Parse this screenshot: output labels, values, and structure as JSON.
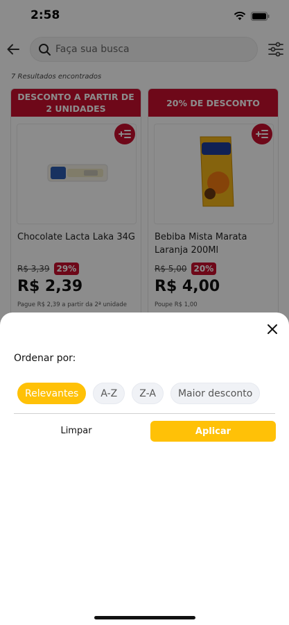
{
  "status_bar": {
    "time": "2:58",
    "wifi_icon": "wifi-icon",
    "battery_icon": "battery-icon"
  },
  "header": {
    "back_icon": "arrow-left-icon",
    "search_icon": "search-icon",
    "search_placeholder": "Faça sua busca",
    "filter_icon": "sliders-icon"
  },
  "results": {
    "count_text": "7 Resultados encontrados"
  },
  "products": [
    {
      "banner": "DESCONTO A PARTIR DE 2 UNIDADES",
      "name": "Chocolate Lacta Laka 34G",
      "old_price": "R$ 3,39",
      "discount": "29%",
      "price": "R$ 2,39",
      "note": "Pague R$ 2,39 a partir da 2ª unidade"
    },
    {
      "banner": "20% DE DESCONTO",
      "name": "Bebiba Mista Marata Laranja 200Ml",
      "old_price": "R$ 5,00",
      "discount": "20%",
      "price": "R$ 4,00",
      "note": "Poupe R$ 1,00"
    }
  ],
  "sort_sheet": {
    "close_icon": "close-icon",
    "title": "Ordenar por:",
    "options": [
      {
        "label": "Relevantes",
        "selected": true
      },
      {
        "label": "A-Z",
        "selected": false
      },
      {
        "label": "Z-A",
        "selected": false
      },
      {
        "label": "Maior desconto",
        "selected": false
      }
    ],
    "clear_label": "Limpar",
    "apply_label": "Aplicar"
  },
  "colors": {
    "accent_yellow": "#ffc107",
    "brand_red": "#c8102e",
    "overlay": "rgba(0,0,0,0.45)"
  }
}
